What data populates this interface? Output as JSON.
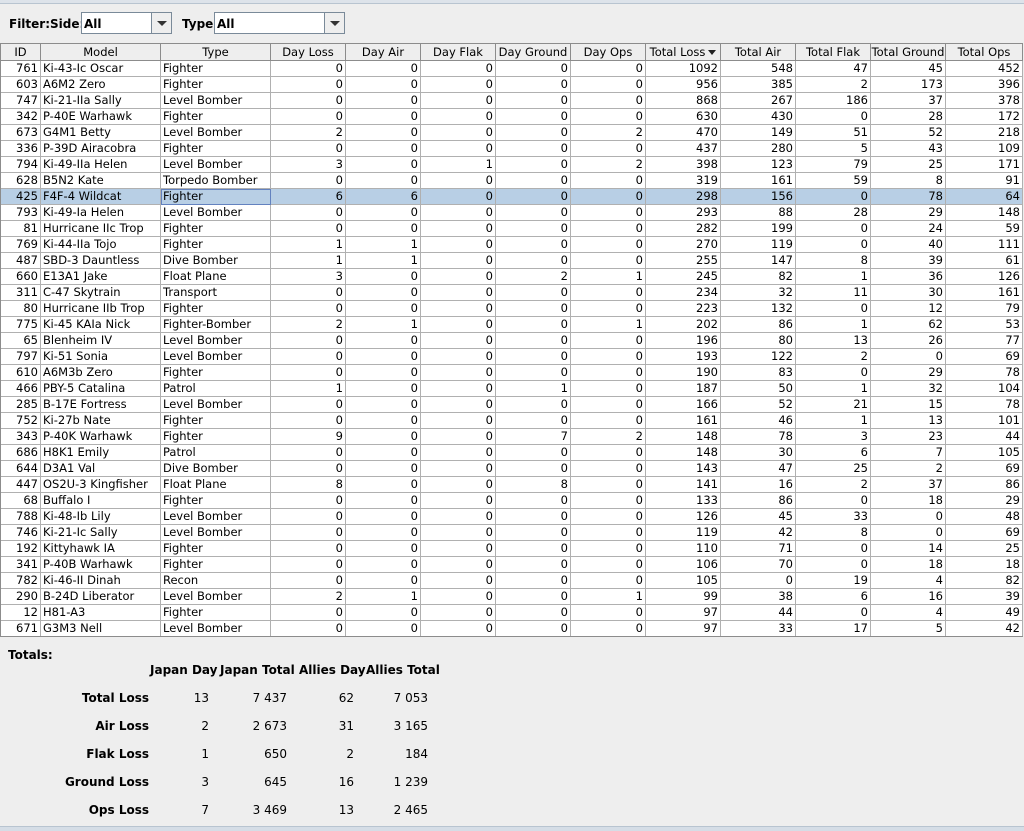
{
  "filter": {
    "title": "Filter:",
    "side_label": "Side:",
    "side_value": "All",
    "type_label": "Type:",
    "type_value": "All"
  },
  "columns": [
    "ID",
    "Model",
    "Type",
    "Day Loss",
    "Day Air",
    "Day Flak",
    "Day Ground",
    "Day Ops",
    "Total Loss",
    "Total Air",
    "Total Flak",
    "Total Ground",
    "Total Ops"
  ],
  "sort_column": "Total Loss",
  "selected_row": 8,
  "rows": [
    [
      "761",
      "Ki-43-Ic Oscar",
      "Fighter",
      "0",
      "0",
      "0",
      "0",
      "0",
      "1092",
      "548",
      "47",
      "45",
      "452"
    ],
    [
      "603",
      "A6M2 Zero",
      "Fighter",
      "0",
      "0",
      "0",
      "0",
      "0",
      "956",
      "385",
      "2",
      "173",
      "396"
    ],
    [
      "747",
      "Ki-21-IIa Sally",
      "Level Bomber",
      "0",
      "0",
      "0",
      "0",
      "0",
      "868",
      "267",
      "186",
      "37",
      "378"
    ],
    [
      "342",
      "P-40E Warhawk",
      "Fighter",
      "0",
      "0",
      "0",
      "0",
      "0",
      "630",
      "430",
      "0",
      "28",
      "172"
    ],
    [
      "673",
      "G4M1 Betty",
      "Level Bomber",
      "2",
      "0",
      "0",
      "0",
      "2",
      "470",
      "149",
      "51",
      "52",
      "218"
    ],
    [
      "336",
      "P-39D Airacobra",
      "Fighter",
      "0",
      "0",
      "0",
      "0",
      "0",
      "437",
      "280",
      "5",
      "43",
      "109"
    ],
    [
      "794",
      "Ki-49-IIa Helen",
      "Level Bomber",
      "3",
      "0",
      "1",
      "0",
      "2",
      "398",
      "123",
      "79",
      "25",
      "171"
    ],
    [
      "628",
      "B5N2 Kate",
      "Torpedo Bomber",
      "0",
      "0",
      "0",
      "0",
      "0",
      "319",
      "161",
      "59",
      "8",
      "91"
    ],
    [
      "425",
      "F4F-4 Wildcat",
      "Fighter",
      "6",
      "6",
      "0",
      "0",
      "0",
      "298",
      "156",
      "0",
      "78",
      "64"
    ],
    [
      "793",
      "Ki-49-Ia Helen",
      "Level Bomber",
      "0",
      "0",
      "0",
      "0",
      "0",
      "293",
      "88",
      "28",
      "29",
      "148"
    ],
    [
      "81",
      "Hurricane IIc Trop",
      "Fighter",
      "0",
      "0",
      "0",
      "0",
      "0",
      "282",
      "199",
      "0",
      "24",
      "59"
    ],
    [
      "769",
      "Ki-44-IIa Tojo",
      "Fighter",
      "1",
      "1",
      "0",
      "0",
      "0",
      "270",
      "119",
      "0",
      "40",
      "111"
    ],
    [
      "487",
      "SBD-3 Dauntless",
      "Dive Bomber",
      "1",
      "1",
      "0",
      "0",
      "0",
      "255",
      "147",
      "8",
      "39",
      "61"
    ],
    [
      "660",
      "E13A1 Jake",
      "Float Plane",
      "3",
      "0",
      "0",
      "2",
      "1",
      "245",
      "82",
      "1",
      "36",
      "126"
    ],
    [
      "311",
      "C-47 Skytrain",
      "Transport",
      "0",
      "0",
      "0",
      "0",
      "0",
      "234",
      "32",
      "11",
      "30",
      "161"
    ],
    [
      "80",
      "Hurricane IIb Trop",
      "Fighter",
      "0",
      "0",
      "0",
      "0",
      "0",
      "223",
      "132",
      "0",
      "12",
      "79"
    ],
    [
      "775",
      "Ki-45 KAIa Nick",
      "Fighter-Bomber",
      "2",
      "1",
      "0",
      "0",
      "1",
      "202",
      "86",
      "1",
      "62",
      "53"
    ],
    [
      "65",
      "Blenheim IV",
      "Level Bomber",
      "0",
      "0",
      "0",
      "0",
      "0",
      "196",
      "80",
      "13",
      "26",
      "77"
    ],
    [
      "797",
      "Ki-51 Sonia",
      "Level Bomber",
      "0",
      "0",
      "0",
      "0",
      "0",
      "193",
      "122",
      "2",
      "0",
      "69"
    ],
    [
      "610",
      "A6M3b Zero",
      "Fighter",
      "0",
      "0",
      "0",
      "0",
      "0",
      "190",
      "83",
      "0",
      "29",
      "78"
    ],
    [
      "466",
      "PBY-5 Catalina",
      "Patrol",
      "1",
      "0",
      "0",
      "1",
      "0",
      "187",
      "50",
      "1",
      "32",
      "104"
    ],
    [
      "285",
      "B-17E Fortress",
      "Level Bomber",
      "0",
      "0",
      "0",
      "0",
      "0",
      "166",
      "52",
      "21",
      "15",
      "78"
    ],
    [
      "752",
      "Ki-27b Nate",
      "Fighter",
      "0",
      "0",
      "0",
      "0",
      "0",
      "161",
      "46",
      "1",
      "13",
      "101"
    ],
    [
      "343",
      "P-40K Warhawk",
      "Fighter",
      "9",
      "0",
      "0",
      "7",
      "2",
      "148",
      "78",
      "3",
      "23",
      "44"
    ],
    [
      "686",
      "H8K1 Emily",
      "Patrol",
      "0",
      "0",
      "0",
      "0",
      "0",
      "148",
      "30",
      "6",
      "7",
      "105"
    ],
    [
      "644",
      "D3A1 Val",
      "Dive Bomber",
      "0",
      "0",
      "0",
      "0",
      "0",
      "143",
      "47",
      "25",
      "2",
      "69"
    ],
    [
      "447",
      "OS2U-3 Kingfisher",
      "Float Plane",
      "8",
      "0",
      "0",
      "8",
      "0",
      "141",
      "16",
      "2",
      "37",
      "86"
    ],
    [
      "68",
      "Buffalo I",
      "Fighter",
      "0",
      "0",
      "0",
      "0",
      "0",
      "133",
      "86",
      "0",
      "18",
      "29"
    ],
    [
      "788",
      "Ki-48-Ib Lily",
      "Level Bomber",
      "0",
      "0",
      "0",
      "0",
      "0",
      "126",
      "45",
      "33",
      "0",
      "48"
    ],
    [
      "746",
      "Ki-21-Ic Sally",
      "Level Bomber",
      "0",
      "0",
      "0",
      "0",
      "0",
      "119",
      "42",
      "8",
      "0",
      "69"
    ],
    [
      "192",
      "Kittyhawk IA",
      "Fighter",
      "0",
      "0",
      "0",
      "0",
      "0",
      "110",
      "71",
      "0",
      "14",
      "25"
    ],
    [
      "341",
      "P-40B Warhawk",
      "Fighter",
      "0",
      "0",
      "0",
      "0",
      "0",
      "106",
      "70",
      "0",
      "18",
      "18"
    ],
    [
      "782",
      "Ki-46-II Dinah",
      "Recon",
      "0",
      "0",
      "0",
      "0",
      "0",
      "105",
      "0",
      "19",
      "4",
      "82"
    ],
    [
      "290",
      "B-24D Liberator",
      "Level Bomber",
      "2",
      "1",
      "0",
      "0",
      "1",
      "99",
      "38",
      "6",
      "16",
      "39"
    ],
    [
      "12",
      "H81-A3",
      "Fighter",
      "0",
      "0",
      "0",
      "0",
      "0",
      "97",
      "44",
      "0",
      "4",
      "49"
    ],
    [
      "671",
      "G3M3 Nell",
      "Level Bomber",
      "0",
      "0",
      "0",
      "0",
      "0",
      "97",
      "33",
      "17",
      "5",
      "42"
    ]
  ],
  "totals": {
    "title": "Totals:",
    "headers": [
      "Japan Day",
      "Japan Total",
      "Allies Day",
      "Allies Total"
    ],
    "rows": [
      {
        "label": "Total Loss",
        "values": [
          "13",
          "7 437",
          "62",
          "7 053"
        ]
      },
      {
        "label": "Air Loss",
        "values": [
          "2",
          "2 673",
          "31",
          "3 165"
        ]
      },
      {
        "label": "Flak Loss",
        "values": [
          "1",
          "650",
          "2",
          "184"
        ]
      },
      {
        "label": "Ground Loss",
        "values": [
          "3",
          "645",
          "16",
          "1 239"
        ]
      },
      {
        "label": "Ops Loss",
        "values": [
          "7",
          "3 469",
          "13",
          "2 465"
        ]
      }
    ]
  }
}
